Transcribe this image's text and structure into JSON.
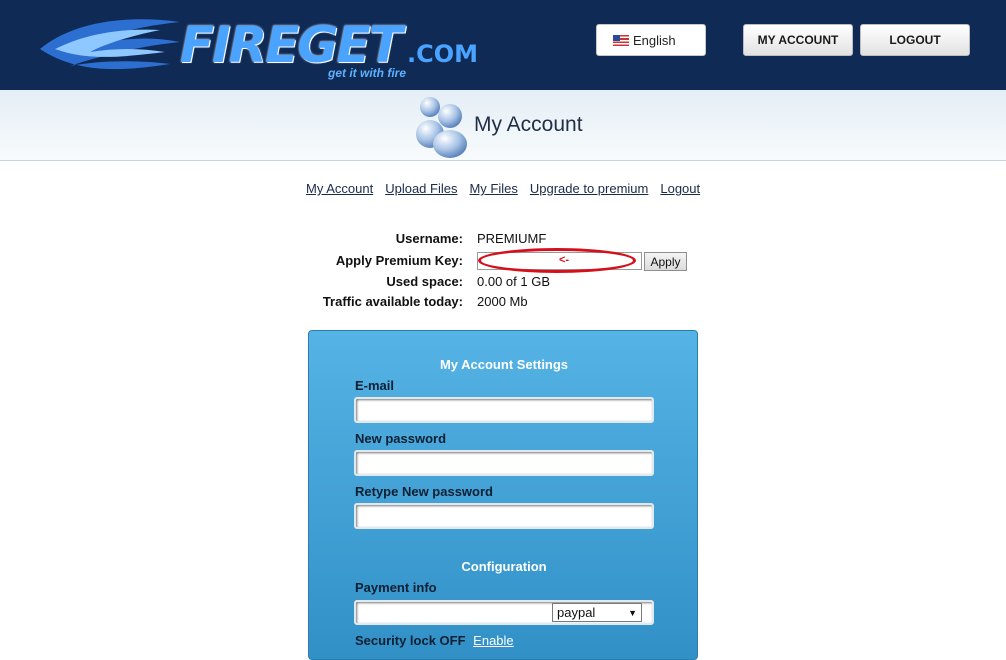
{
  "header": {
    "logo_text": "FIREGET",
    "logo_com": ".COM",
    "tagline": "get it with fire",
    "language_label": "English",
    "my_account_label": "MY ACCOUNT",
    "logout_label": "LOGOUT"
  },
  "banner": {
    "title": "My Account"
  },
  "nav": {
    "items": [
      "My Account",
      "Upload Files",
      "My Files",
      "Upgrade to premium",
      "Logout"
    ]
  },
  "info": {
    "username_label": "Username:",
    "username_value": "PREMIUMF",
    "premium_key_label": "Apply Premium Key:",
    "premium_key_value": "",
    "annotation_text": "<-",
    "apply_label": "Apply",
    "used_space_label": "Used space:",
    "used_space_value": "0.00 of 1 GB",
    "traffic_label": "Traffic available today:",
    "traffic_value": "2000 Mb"
  },
  "settings": {
    "title": "My Account Settings",
    "email_label": "E-mail",
    "email_value": "",
    "new_password_label": "New password",
    "retype_password_label": "Retype New password",
    "config_title": "Configuration",
    "payment_label": "Payment info",
    "payment_value": "",
    "payment_method": "paypal",
    "security_text": "Security lock OFF",
    "enable_label": "Enable"
  },
  "colors": {
    "header_bg": "#0f2a55",
    "panel_bg": "#3f9fd6",
    "annotation_red": "#d60f1a"
  }
}
